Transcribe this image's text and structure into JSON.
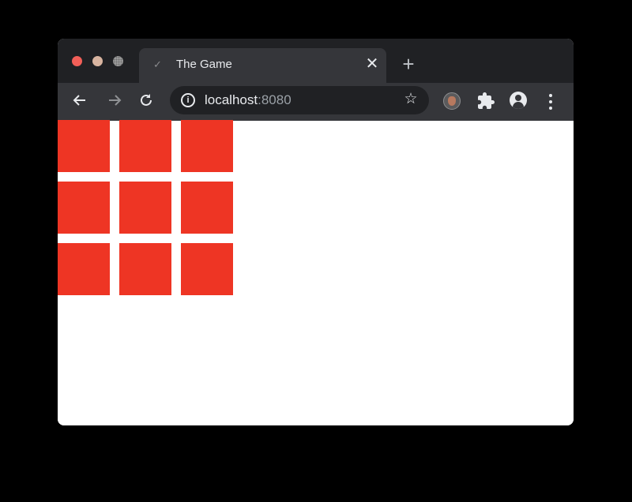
{
  "browser": {
    "tab": {
      "title": "The Game",
      "favicon_icon": "check-icon",
      "close_glyph": "✕"
    },
    "new_tab_glyph": "+",
    "address": {
      "host": "localhost",
      "port": ":8080"
    },
    "colors": {
      "frame": "#202124",
      "toolbar": "#35363a"
    }
  },
  "game": {
    "tile_color": "#ee3524",
    "rows": 3,
    "columns": 3,
    "tiles": [
      {
        "row": 1,
        "col": 1
      },
      {
        "row": 1,
        "col": 2
      },
      {
        "row": 1,
        "col": 3
      },
      {
        "row": 2,
        "col": 1
      },
      {
        "row": 2,
        "col": 2
      },
      {
        "row": 2,
        "col": 3
      },
      {
        "row": 3,
        "col": 1
      },
      {
        "row": 3,
        "col": 2
      },
      {
        "row": 3,
        "col": 3
      }
    ]
  }
}
